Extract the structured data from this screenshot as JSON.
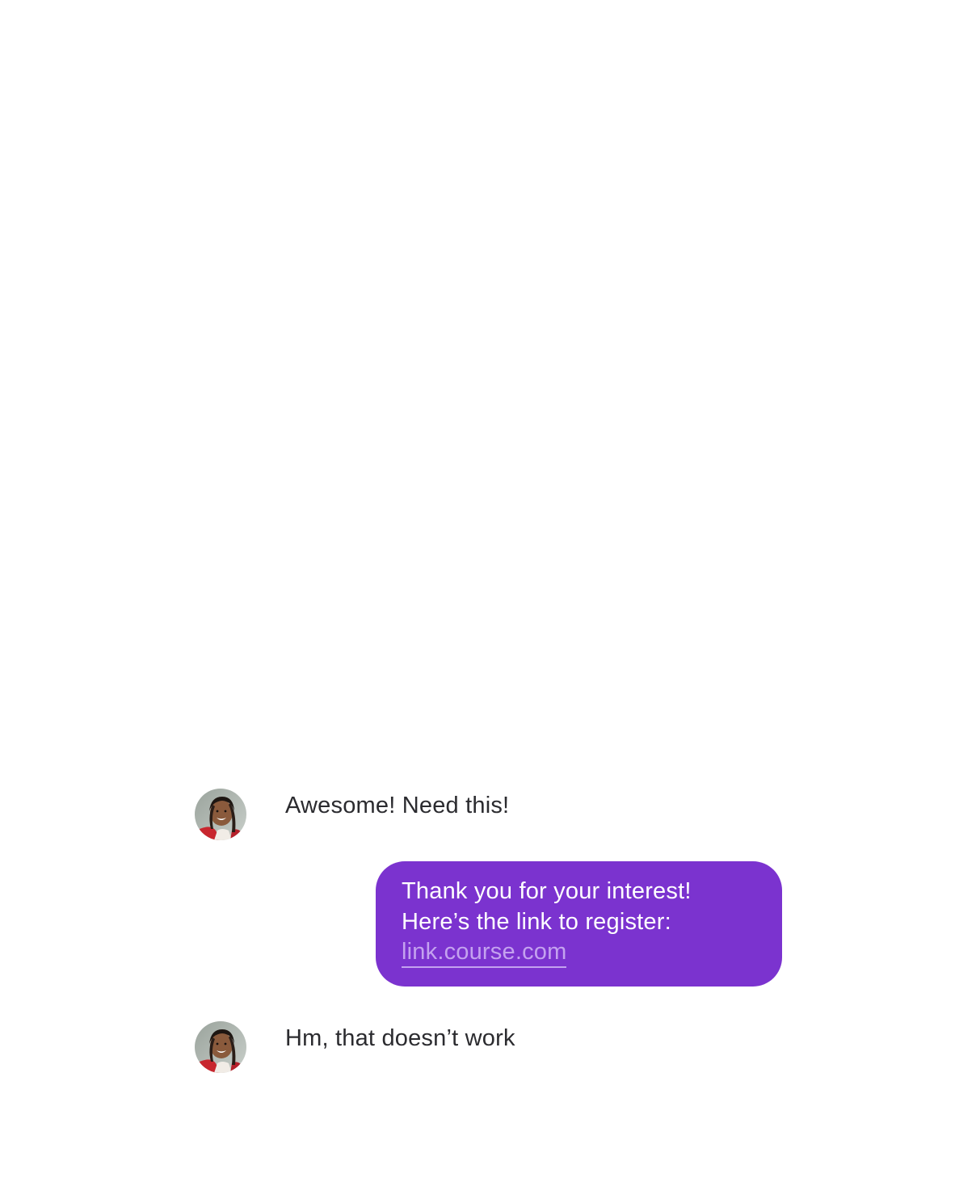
{
  "messages": [
    {
      "direction": "incoming",
      "text": "Awesome! Need this!",
      "avatar": "user-avatar-photo"
    },
    {
      "direction": "outgoing",
      "line1": "Thank you for your interest!",
      "line2": "Here’s the link to register:",
      "link": "link.course.com"
    },
    {
      "direction": "incoming",
      "text": "Hm, that doesn’t work",
      "avatar": "user-avatar-photo"
    }
  ],
  "colors": {
    "bubble_background": "#7b33cf",
    "bubble_text": "#ffffff",
    "link_text": "#c4a2ef",
    "incoming_text": "#2b2b2f",
    "page_background": "#ffffff"
  }
}
